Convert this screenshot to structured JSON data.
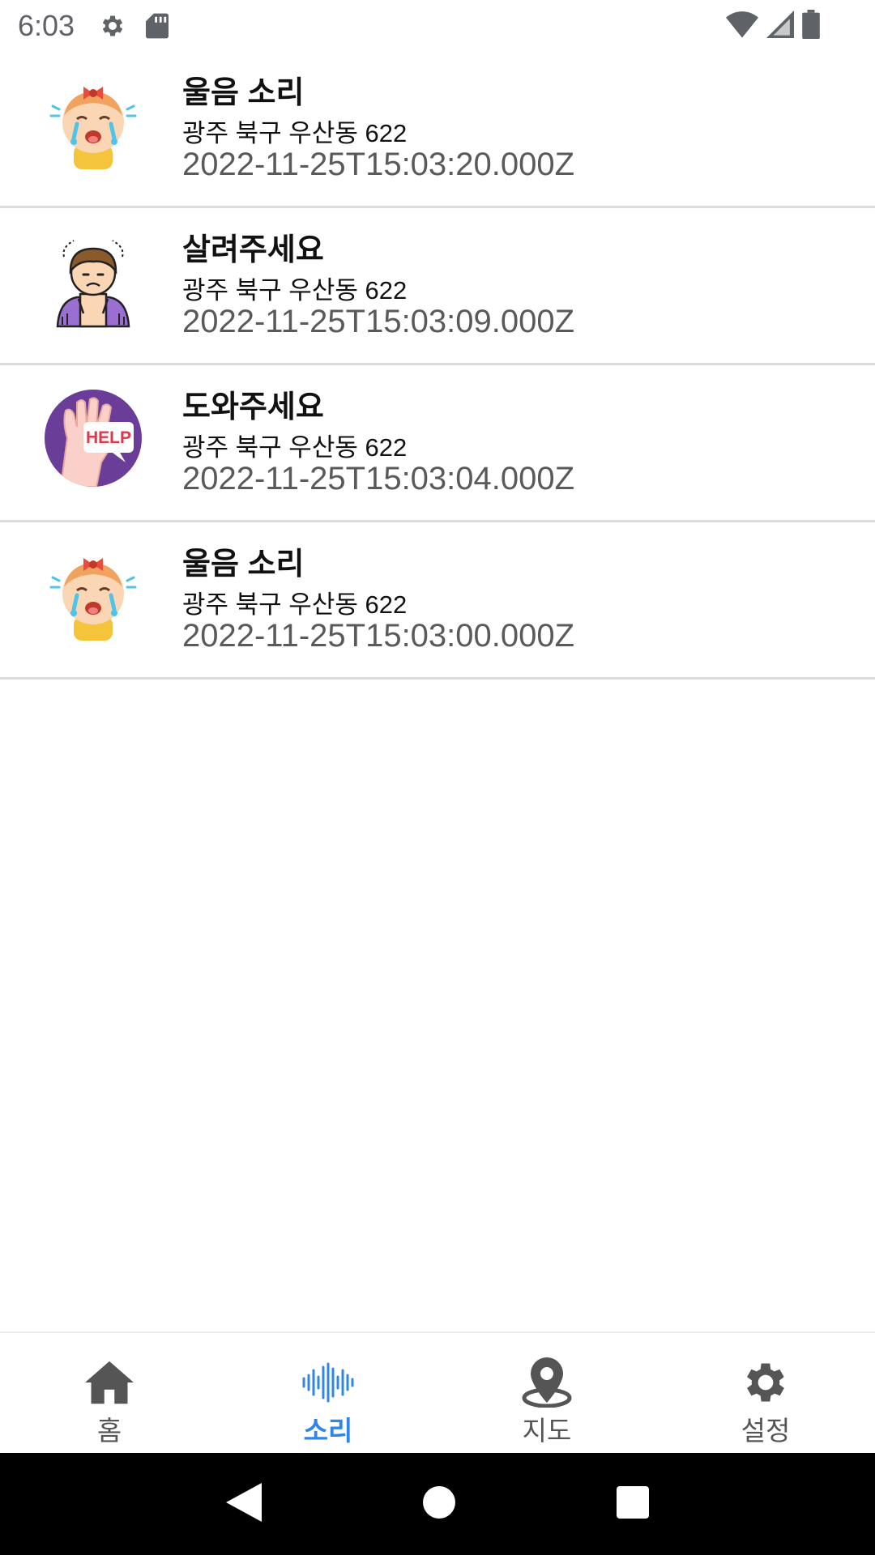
{
  "status_bar": {
    "time": "6:03",
    "icons_left": [
      "settings-icon",
      "sd-card-icon"
    ],
    "icons_right": [
      "wifi-icon",
      "signal-icon",
      "battery-icon"
    ]
  },
  "alerts": [
    {
      "icon": "crying-baby-icon",
      "title": "울음 소리",
      "address": "광주 북구 우산동 622",
      "time": "2022-11-25T15:03:20.000Z"
    },
    {
      "icon": "distressed-person-icon",
      "title": "살려주세요",
      "address": "광주 북구 우산동 622",
      "time": "2022-11-25T15:03:09.000Z"
    },
    {
      "icon": "help-hand-icon",
      "title": "도와주세요",
      "address": "광주 북구 우산동 622",
      "time": "2022-11-25T15:03:04.000Z",
      "badge": "HELP"
    },
    {
      "icon": "crying-baby-icon",
      "title": "울음 소리",
      "address": "광주 북구 우산동 622",
      "time": "2022-11-25T15:03:00.000Z"
    }
  ],
  "tabs": [
    {
      "label": "홈",
      "icon": "home-icon",
      "active": false
    },
    {
      "label": "소리",
      "icon": "sound-wave-icon",
      "active": true
    },
    {
      "label": "지도",
      "icon": "map-pin-icon",
      "active": false
    },
    {
      "label": "설정",
      "icon": "gear-icon",
      "active": false
    }
  ],
  "colors": {
    "active_tab": "#2f86e8",
    "inactive_tab": "#555555",
    "divider": "#dcdcdc",
    "nav_bar": "#000000"
  }
}
